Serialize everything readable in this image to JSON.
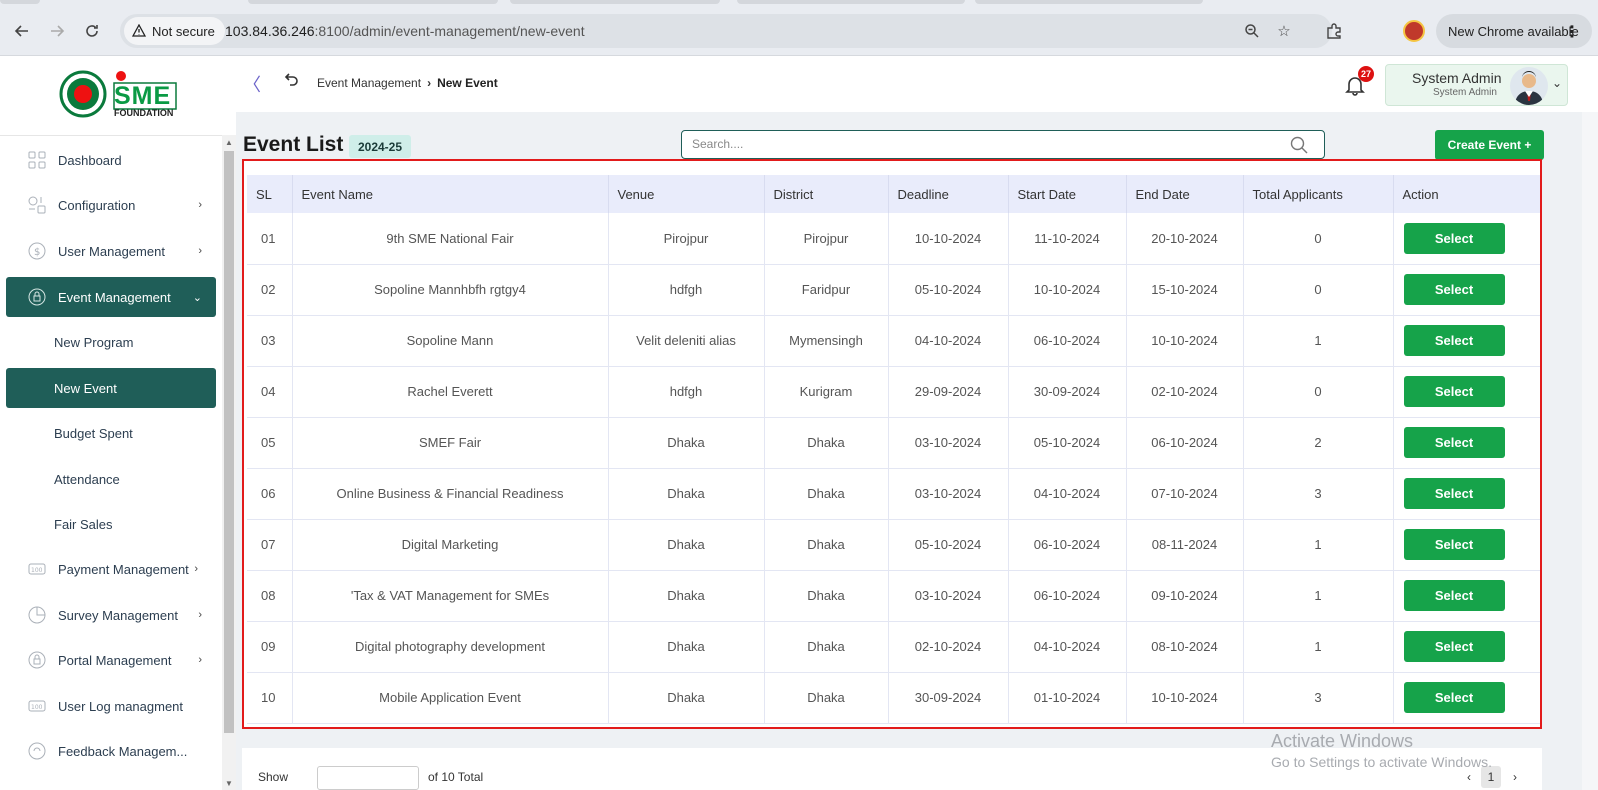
{
  "browser": {
    "security_label": "Not secure",
    "url_host": "103.84.36.246",
    "url_path": ":8100/admin/event-management/new-event",
    "update_label": "New Chrome available"
  },
  "header": {
    "breadcrumb_parent": "Event Management",
    "breadcrumb_separator": "›",
    "breadcrumb_current": "New Event",
    "notification_count": "27",
    "user_name": "System Admin",
    "user_role": "System Admin"
  },
  "logo": {
    "text": "SME",
    "subtext": "FOUNDATION"
  },
  "sidebar": {
    "items": [
      {
        "label": "Dashboard",
        "icon": "grid-icon"
      },
      {
        "label": "Configuration",
        "icon": "config-icon"
      },
      {
        "label": "User Management",
        "icon": "user-icon"
      },
      {
        "label": "Event Management",
        "icon": "lock-icon"
      },
      {
        "label": "Payment Management",
        "icon": "payment-icon"
      },
      {
        "label": "Survey Management",
        "icon": "pie-icon"
      },
      {
        "label": "Portal Management",
        "icon": "lock-icon"
      },
      {
        "label": "User Log managment",
        "icon": "log-icon"
      },
      {
        "label": "Feedback Managem...",
        "icon": "feedback-icon"
      }
    ],
    "subitems": [
      {
        "label": "New Program"
      },
      {
        "label": "New Event"
      },
      {
        "label": "Budget Spent"
      },
      {
        "label": "Attendance"
      },
      {
        "label": "Fair Sales"
      }
    ]
  },
  "main": {
    "title": "Event List",
    "fiscal_year": "2024-25",
    "search_placeholder": "Search....",
    "create_button": "Create Event +",
    "columns": [
      "SL",
      "Event Name",
      "Venue",
      "District",
      "Deadline",
      "Start Date",
      "End Date",
      "Total Applicants",
      "Action"
    ],
    "rows": [
      {
        "sl": "01",
        "name": "9th SME National Fair",
        "venue": "Pirojpur",
        "district": "Pirojpur",
        "deadline": "10-10-2024",
        "start": "11-10-2024",
        "end": "20-10-2024",
        "applicants": "0",
        "action": "Select"
      },
      {
        "sl": "02",
        "name": "Sopoline Mannhbfh rgtgy4",
        "venue": "hdfgh",
        "district": "Faridpur",
        "deadline": "05-10-2024",
        "start": "10-10-2024",
        "end": "15-10-2024",
        "applicants": "0",
        "action": "Select"
      },
      {
        "sl": "03",
        "name": "Sopoline Mann",
        "venue": "Velit deleniti alias",
        "district": "Mymensingh",
        "deadline": "04-10-2024",
        "start": "06-10-2024",
        "end": "10-10-2024",
        "applicants": "1",
        "action": "Select"
      },
      {
        "sl": "04",
        "name": "Rachel Everett",
        "venue": "hdfgh",
        "district": "Kurigram",
        "deadline": "29-09-2024",
        "start": "30-09-2024",
        "end": "02-10-2024",
        "applicants": "0",
        "action": "Select"
      },
      {
        "sl": "05",
        "name": "SMEF Fair",
        "venue": "Dhaka",
        "district": "Dhaka",
        "deadline": "03-10-2024",
        "start": "05-10-2024",
        "end": "06-10-2024",
        "applicants": "2",
        "action": "Select"
      },
      {
        "sl": "06",
        "name": "Online Business & Financial Readiness",
        "venue": "Dhaka",
        "district": "Dhaka",
        "deadline": "03-10-2024",
        "start": "04-10-2024",
        "end": "07-10-2024",
        "applicants": "3",
        "action": "Select"
      },
      {
        "sl": "07",
        "name": "Digital Marketing",
        "venue": "Dhaka",
        "district": "Dhaka",
        "deadline": "05-10-2024",
        "start": "06-10-2024",
        "end": "08-11-2024",
        "applicants": "1",
        "action": "Select"
      },
      {
        "sl": "08",
        "name": "'Tax & VAT Management for SMEs",
        "venue": "Dhaka",
        "district": "Dhaka",
        "deadline": "03-10-2024",
        "start": "06-10-2024",
        "end": "09-10-2024",
        "applicants": "1",
        "action": "Select"
      },
      {
        "sl": "09",
        "name": "Digital photography development",
        "venue": "Dhaka",
        "district": "Dhaka",
        "deadline": "02-10-2024",
        "start": "04-10-2024",
        "end": "08-10-2024",
        "applicants": "1",
        "action": "Select"
      },
      {
        "sl": "10",
        "name": "Mobile Application Event",
        "venue": "Dhaka",
        "district": "Dhaka",
        "deadline": "30-09-2024",
        "start": "01-10-2024",
        "end": "10-10-2024",
        "applicants": "3",
        "action": "Select"
      }
    ]
  },
  "footer": {
    "show_label": "Show ",
    "total_label": "of 10 Total",
    "current_page": "1"
  },
  "watermark": {
    "line1": "Activate Windows",
    "line2": "Go to Settings to activate Windows."
  },
  "colors": {
    "accent_green": "#16a34a",
    "sidebar_active": "#1f5e58",
    "highlight_border": "#e21b1b"
  }
}
